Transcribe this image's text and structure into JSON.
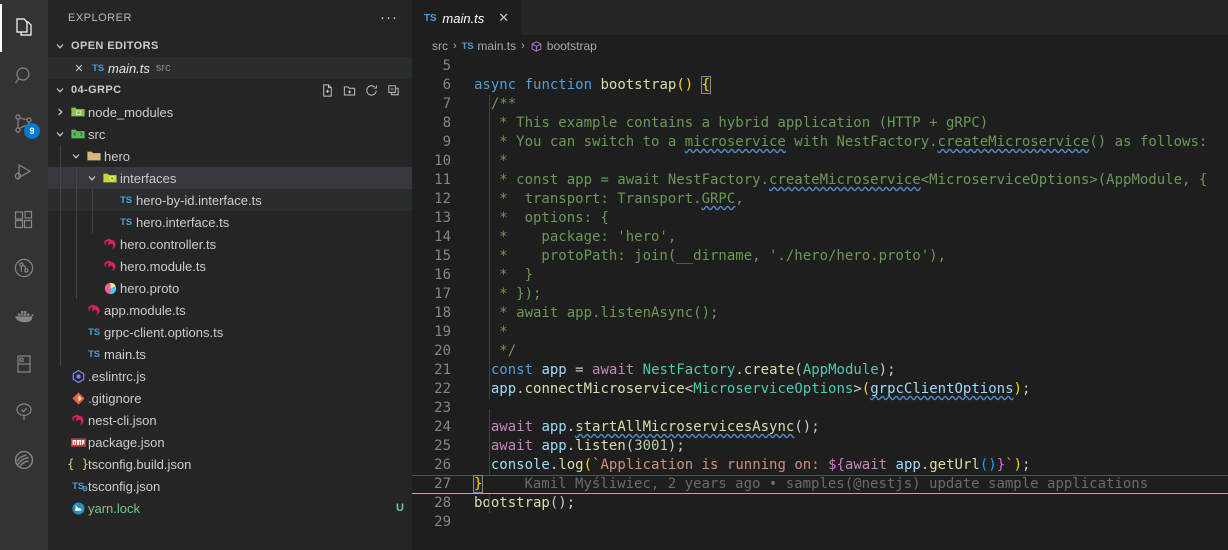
{
  "activity_bar": {
    "items": [
      {
        "name": "explorer",
        "icon": "files-icon",
        "active": true,
        "badge": ""
      },
      {
        "name": "search",
        "icon": "search-icon",
        "active": false,
        "badge": ""
      },
      {
        "name": "source-control",
        "icon": "source-control-icon",
        "active": false,
        "badge": "9"
      },
      {
        "name": "run-and-debug",
        "icon": "run-debug-icon",
        "active": false,
        "badge": ""
      },
      {
        "name": "extensions",
        "icon": "extensions-icon",
        "active": false,
        "badge": ""
      },
      {
        "name": "gitlens",
        "icon": "gitlens-icon",
        "active": false,
        "badge": ""
      },
      {
        "name": "docker",
        "icon": "docker-whale-icon",
        "active": false,
        "badge": ""
      },
      {
        "name": "remote-explorer",
        "icon": "remote-explorer-icon",
        "active": false,
        "badge": ""
      },
      {
        "name": "testing",
        "icon": "testing-beaker-icon",
        "active": false,
        "badge": ""
      },
      {
        "name": "thunder-client",
        "icon": "thunder-client-icon",
        "active": false,
        "badge": ""
      }
    ]
  },
  "sidebar": {
    "title": "EXPLORER",
    "more_actions": "···",
    "open_editors": {
      "header": "OPEN EDITORS",
      "items": [
        {
          "name": "main.ts",
          "suffix": "src",
          "icon": "ts-icon",
          "close": "✕"
        }
      ]
    },
    "workspace": {
      "header": "04-GRPC",
      "actions": [
        "new-file-icon",
        "new-folder-icon",
        "refresh-icon",
        "collapse-all-icon"
      ],
      "tree": [
        {
          "label": "node_modules",
          "type": "folder",
          "icon": "folder-node-modules-icon",
          "depth": 1,
          "expanded": false,
          "state": ""
        },
        {
          "label": "src",
          "type": "folder",
          "icon": "folder-src-icon",
          "depth": 1,
          "expanded": true,
          "state": ""
        },
        {
          "label": "hero",
          "type": "folder",
          "icon": "folder-icon",
          "depth": 2,
          "expanded": true,
          "state": ""
        },
        {
          "label": "interfaces",
          "type": "folder",
          "icon": "folder-interfaces-icon",
          "depth": 3,
          "expanded": true,
          "state": "selected"
        },
        {
          "label": "hero-by-id.interface.ts",
          "type": "file",
          "icon": "ts-icon",
          "depth": 4,
          "expanded": false,
          "state": "focused"
        },
        {
          "label": "hero.interface.ts",
          "type": "file",
          "icon": "ts-icon",
          "depth": 4,
          "expanded": false,
          "state": ""
        },
        {
          "label": "hero.controller.ts",
          "type": "file",
          "icon": "nest-icon",
          "depth": 3,
          "expanded": false,
          "state": ""
        },
        {
          "label": "hero.module.ts",
          "type": "file",
          "icon": "nest-icon",
          "depth": 3,
          "expanded": false,
          "state": ""
        },
        {
          "label": "hero.proto",
          "type": "file",
          "icon": "proto-icon",
          "depth": 3,
          "expanded": false,
          "state": ""
        },
        {
          "label": "app.module.ts",
          "type": "file",
          "icon": "nest-icon",
          "depth": 2,
          "expanded": false,
          "state": ""
        },
        {
          "label": "grpc-client.options.ts",
          "type": "file",
          "icon": "ts-icon",
          "depth": 2,
          "expanded": false,
          "state": ""
        },
        {
          "label": "main.ts",
          "type": "file",
          "icon": "ts-icon",
          "depth": 2,
          "expanded": false,
          "state": ""
        },
        {
          "label": ".eslintrc.js",
          "type": "file",
          "icon": "eslint-icon",
          "depth": 1,
          "expanded": false,
          "state": ""
        },
        {
          "label": ".gitignore",
          "type": "file",
          "icon": "git-icon",
          "depth": 1,
          "expanded": false,
          "state": ""
        },
        {
          "label": "nest-cli.json",
          "type": "file",
          "icon": "nest-icon",
          "depth": 1,
          "expanded": false,
          "state": ""
        },
        {
          "label": "package.json",
          "type": "file",
          "icon": "npm-icon",
          "depth": 1,
          "expanded": false,
          "state": ""
        },
        {
          "label": "tsconfig.build.json",
          "type": "file",
          "icon": "json-icon",
          "depth": 1,
          "expanded": false,
          "state": ""
        },
        {
          "label": "tsconfig.json",
          "type": "file",
          "icon": "tsconfig-icon",
          "depth": 1,
          "expanded": false,
          "state": ""
        },
        {
          "label": "yarn.lock",
          "type": "file",
          "icon": "yarn-icon",
          "depth": 1,
          "expanded": false,
          "state": "untracked",
          "git_badge": "U"
        }
      ]
    }
  },
  "editor": {
    "tab": {
      "label": "main.ts",
      "icon": "ts-icon",
      "close": "✕"
    },
    "breadcrumbs": [
      {
        "label": "src",
        "icon": ""
      },
      {
        "label": "main.ts",
        "icon": "ts-icon"
      },
      {
        "label": "bootstrap",
        "icon": "symbol-function-icon"
      }
    ],
    "breadcrumb_separator": "›",
    "first_visible_line": 5,
    "cursor_line": 27,
    "blame_annotation": "Kamil Myśliwiec, 2 years ago • samples(@nestjs) update sample applications",
    "lines": [
      {
        "n": 5,
        "text": ""
      },
      {
        "n": 6,
        "text": "async function bootstrap() {"
      },
      {
        "n": 7,
        "text": "  /**"
      },
      {
        "n": 8,
        "text": "   * This example contains a hybrid application (HTTP + gRPC)"
      },
      {
        "n": 9,
        "text": "   * You can switch to a microservice with NestFactory.createMicroservice() as follows:"
      },
      {
        "n": 10,
        "text": "   *"
      },
      {
        "n": 11,
        "text": "   * const app = await NestFactory.createMicroservice<MicroserviceOptions>(AppModule, {"
      },
      {
        "n": 12,
        "text": "   *  transport: Transport.GRPC,"
      },
      {
        "n": 13,
        "text": "   *  options: {"
      },
      {
        "n": 14,
        "text": "   *    package: 'hero',"
      },
      {
        "n": 15,
        "text": "   *    protoPath: join(__dirname, './hero/hero.proto'),"
      },
      {
        "n": 16,
        "text": "   *  }"
      },
      {
        "n": 17,
        "text": "   * });"
      },
      {
        "n": 18,
        "text": "   * await app.listenAsync();"
      },
      {
        "n": 19,
        "text": "   *"
      },
      {
        "n": 20,
        "text": "   */"
      },
      {
        "n": 21,
        "text": "  const app = await NestFactory.create(AppModule);"
      },
      {
        "n": 22,
        "text": "  app.connectMicroservice<MicroserviceOptions>(grpcClientOptions);"
      },
      {
        "n": 23,
        "text": ""
      },
      {
        "n": 24,
        "text": "  await app.startAllMicroservicesAsync();"
      },
      {
        "n": 25,
        "text": "  await app.listen(3001);"
      },
      {
        "n": 26,
        "text": "  console.log(`Application is running on: ${await app.getUrl()}`);"
      },
      {
        "n": 27,
        "text": "}"
      },
      {
        "n": 28,
        "text": "bootstrap();"
      },
      {
        "n": 29,
        "text": ""
      }
    ]
  },
  "colors": {
    "editor_bg": "#1e1e1e",
    "sidebar_bg": "#252526",
    "activity_bg": "#333333",
    "badge_bg": "#007acc",
    "keyword": "#569cd6",
    "control": "#c586c0",
    "function": "#dcdcaa",
    "comment": "#6a9955",
    "variable": "#9cdcfe",
    "type": "#4ec9b0",
    "string": "#ce9178",
    "number": "#b5cea8",
    "untracked": "#73c991",
    "cursor_line_border": "#7ec699"
  }
}
